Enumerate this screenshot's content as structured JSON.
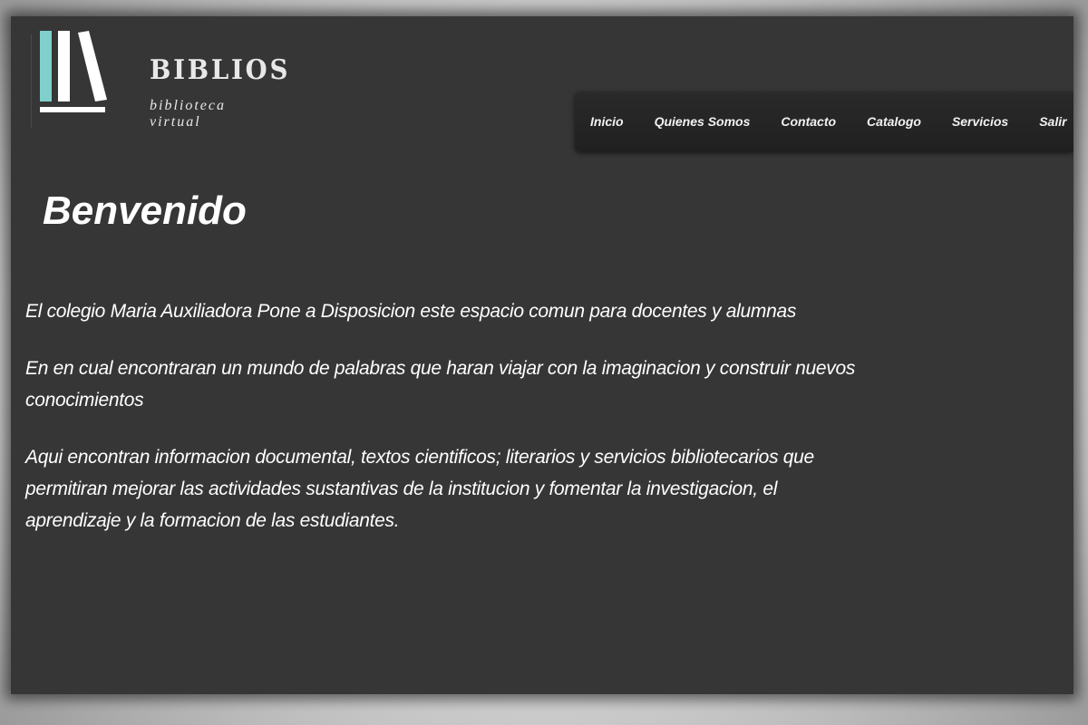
{
  "brand": {
    "name": "BIBLIOS",
    "tagline": "biblioteca virtual",
    "icon": "books-icon",
    "accent_color": "#7fd0cc"
  },
  "nav": {
    "items": [
      {
        "label": "Inicio"
      },
      {
        "label": "Quienes Somos"
      },
      {
        "label": "Contacto"
      },
      {
        "label": "Catalogo"
      },
      {
        "label": "Servicios"
      },
      {
        "label": "Salir"
      }
    ]
  },
  "main": {
    "heading": "Benvenido",
    "paragraphs": [
      "El colegio Maria Auxiliadora Pone a Disposicion este espacio comun para docentes y alumnas",
      "En en cual encontraran un mundo de palabras que haran viajar con la imaginacion y construir nuevos conocimientos",
      "Aqui encontran informacion documental, textos cientificos; literarios y servicios bibliotecarios que permitiran mejorar las actividades sustantivas de la institucion y fomentar la investigacion, el aprendizaje y la formacion de las estudiantes."
    ]
  }
}
